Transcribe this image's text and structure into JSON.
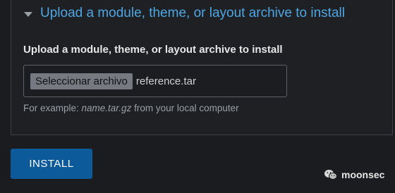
{
  "section": {
    "summary": "Upload a module, theme, or layout archive to install"
  },
  "upload": {
    "label": "Upload a module, theme, or layout archive to install",
    "choose_button": "Seleccionar archivo",
    "file_name": "reference.tar",
    "help_prefix": "For example: ",
    "help_example": "name.tar.gz",
    "help_suffix": " from your local computer"
  },
  "actions": {
    "install_label": "INSTALL"
  },
  "watermark": {
    "text": "moonsec",
    "icon": "wechat-icon"
  },
  "colors": {
    "link": "#4ea6e2",
    "primary_button": "#0d5a9b",
    "background": "#1a1c1f"
  }
}
